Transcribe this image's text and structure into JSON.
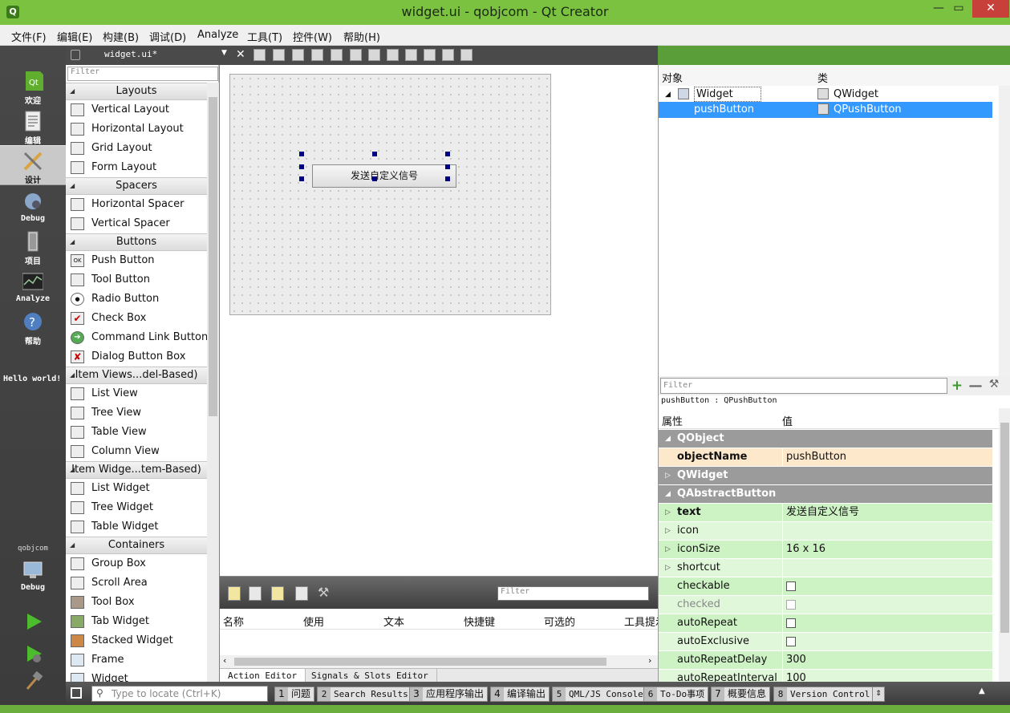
{
  "window": {
    "title": "widget.ui - qobjcom - Qt Creator",
    "app_icon": "qt-icon"
  },
  "menu": [
    "文件(F)",
    "编辑(E)",
    "构建(B)",
    "调试(D)",
    "Analyze",
    "工具(T)",
    "控件(W)",
    "帮助(H)"
  ],
  "modes": [
    {
      "label": "欢迎",
      "icon": "qt-logo-icon"
    },
    {
      "label": "编辑",
      "icon": "document-icon"
    },
    {
      "label": "设计",
      "icon": "design-pencil-icon",
      "active": true
    },
    {
      "label": "Debug",
      "icon": "debug-icon"
    },
    {
      "label": "项目",
      "icon": "project-icon"
    },
    {
      "label": "Analyze",
      "icon": "analyze-icon"
    },
    {
      "label": "帮助",
      "icon": "help-icon"
    }
  ],
  "hello": "Hello world!",
  "project_label": "qobjcom",
  "kit_label": "Debug",
  "editor": {
    "document": "widget.ui*"
  },
  "widgetbox": {
    "filter_placeholder": "Filter",
    "sections": [
      {
        "title": "Layouts",
        "items": [
          "Vertical Layout",
          "Horizontal Layout",
          "Grid Layout",
          "Form Layout"
        ]
      },
      {
        "title": "Spacers",
        "items": [
          "Horizontal Spacer",
          "Vertical Spacer"
        ]
      },
      {
        "title": "Buttons",
        "items": [
          "Push Button",
          "Tool Button",
          "Radio Button",
          "Check Box",
          "Command Link Button",
          "Dialog Button Box"
        ]
      },
      {
        "title": "Item Views...del-Based)",
        "items": [
          "List View",
          "Tree View",
          "Table View",
          "Column View"
        ]
      },
      {
        "title": "Item Widge...tem-Based)",
        "items": [
          "List Widget",
          "Tree Widget",
          "Table Widget"
        ]
      },
      {
        "title": "Containers",
        "items": [
          "Group Box",
          "Scroll Area",
          "Tool Box",
          "Tab Widget",
          "Stacked Widget",
          "Frame",
          "Widget"
        ]
      }
    ]
  },
  "form": {
    "button_text": "发送自定义信号"
  },
  "action_editor": {
    "filter_placeholder": "Filter",
    "columns": [
      "名称",
      "使用",
      "文本",
      "快捷键",
      "可选的",
      "工具提示"
    ],
    "tabs": [
      "Action Editor",
      "Signals & Slots Editor"
    ]
  },
  "object_inspector": {
    "headers": [
      "对象",
      "类"
    ],
    "rows": [
      {
        "name": "Widget",
        "class": "QWidget"
      },
      {
        "name": "pushButton",
        "class": "QPushButton",
        "selected": true
      }
    ]
  },
  "property_editor": {
    "filter_placeholder": "Filter",
    "class_line": "pushButton : QPushButton",
    "headers": [
      "属性",
      "值"
    ],
    "rows": [
      {
        "type": "group",
        "name": "QObject",
        "expanded": true
      },
      {
        "type": "obj",
        "name": "objectName",
        "value": "pushButton",
        "bold": true
      },
      {
        "type": "group",
        "name": "QWidget",
        "expanded": false
      },
      {
        "type": "group",
        "name": "QAbstractButton",
        "expanded": true
      },
      {
        "type": "prop",
        "name": "text",
        "value": "发送自定义信号",
        "bold": true,
        "expandable": true
      },
      {
        "type": "prop",
        "name": "icon",
        "value": "",
        "expandable": true
      },
      {
        "type": "prop",
        "name": "iconSize",
        "value": "16 x 16",
        "expandable": true
      },
      {
        "type": "prop",
        "name": "shortcut",
        "value": "",
        "expandable": true
      },
      {
        "type": "prop",
        "name": "checkable",
        "checkbox": true
      },
      {
        "type": "prop",
        "name": "checked",
        "checkbox": true,
        "disabled": true
      },
      {
        "type": "prop",
        "name": "autoRepeat",
        "checkbox": true
      },
      {
        "type": "prop",
        "name": "autoExclusive",
        "checkbox": true
      },
      {
        "type": "prop",
        "name": "autoRepeatDelay",
        "value": "300"
      },
      {
        "type": "prop",
        "name": "autoRepeatInterval",
        "value": "100"
      }
    ]
  },
  "statusbar": {
    "locator_placeholder": "Type to locate (Ctrl+K)",
    "panes": [
      {
        "num": "1",
        "label": "问题"
      },
      {
        "num": "2",
        "label": "Search Results"
      },
      {
        "num": "3",
        "label": "应用程序输出"
      },
      {
        "num": "4",
        "label": "编译输出"
      },
      {
        "num": "5",
        "label": "QML/JS Console"
      },
      {
        "num": "6",
        "label": "To-Do事项"
      },
      {
        "num": "7",
        "label": "概要信息"
      },
      {
        "num": "8",
        "label": "Version Control"
      }
    ]
  },
  "colors": {
    "accent_select": "#3399ff",
    "title_bar": "#7cc241",
    "prop_green": "#cdf2c3",
    "prop_object": "#fde8cc",
    "group_gray": "#9b9b9b"
  }
}
